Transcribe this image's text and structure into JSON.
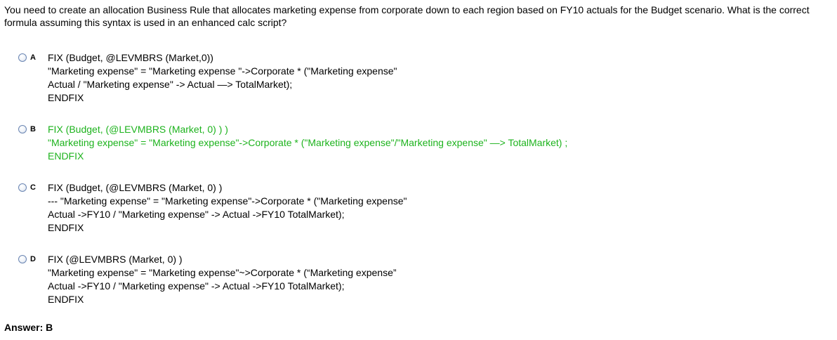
{
  "question": "You need to create an allocation Business Rule that allocates marketing expense from corporate down to each region based on FY10 actuals for the Budget scenario. What is the correct formula assuming this syntax is used in an enhanced calc script?",
  "options": [
    {
      "letter": "A",
      "lines": [
        "FIX (Budget, @LEVMBRS (Market,0))",
        "\"Marketing expense\" = \"Marketing expense \"->Corporate * (\"Marketing expense\"",
        "Actual / \"Marketing expense\" -> Actual —> TotalMarket);",
        "ENDFIX"
      ]
    },
    {
      "letter": "B",
      "lines": [
        "FIX (Budget, (@LEVMBRS (Market, 0) ) )",
        "\"Marketing expense\" = \"Marketing expense\"->Corporate * (\"Marketing expense\"/\"Marketing expense\" —> TotalMarket) ;",
        "ENDFIX"
      ]
    },
    {
      "letter": "C",
      "lines": [
        "FIX (Budget, (@LEVMBRS (Market, 0) )",
        "--- \"Marketing expense\" = \"Marketing expense\"->Corporate * (\"Marketing expense\"",
        "Actual ->FY10 / \"Marketing expense\" -> Actual ->FY10 TotalMarket);",
        "ENDFIX"
      ]
    },
    {
      "letter": "D",
      "lines": [
        "FIX (@LEVMBRS (Market, 0) )",
        "\"Marketing expense\" = \"Marketing expense\"~>Corporate * (“Marketing expense”",
        "Actual ->FY10 / \"Marketing expense\" -> Actual ->FY10 TotalMarket);",
        "ENDFIX"
      ]
    }
  ],
  "answer": "Answer: B",
  "colors": {
    "correct_option": "#1db31d",
    "text": "#000000",
    "radio_border": "#6b86b3"
  }
}
